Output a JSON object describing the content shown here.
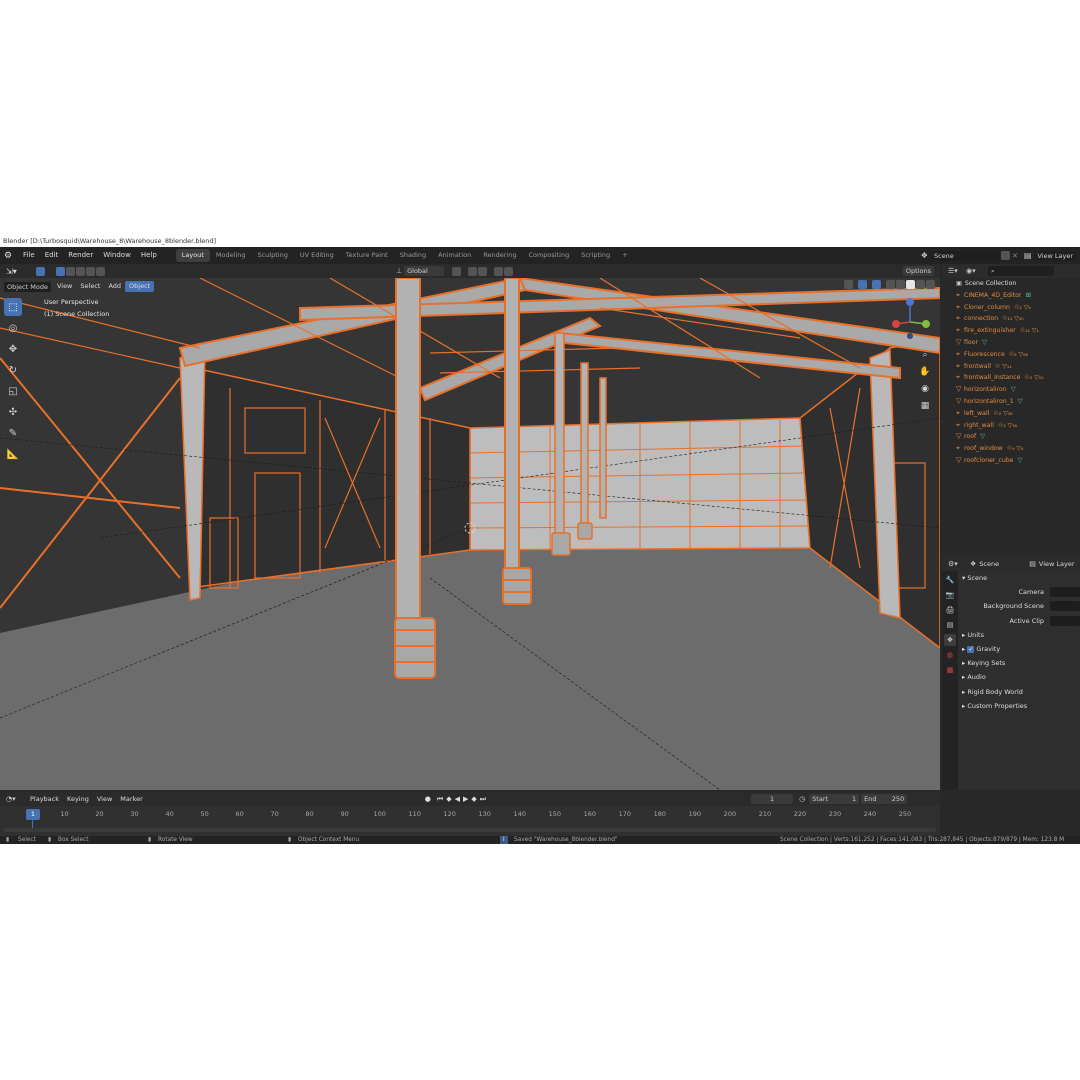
{
  "window_title": "Blender [D:\\Turbosquid\\Warehouse_8\\Warehouse_8blender.blend]",
  "menu": [
    "File",
    "Edit",
    "Render",
    "Window",
    "Help"
  ],
  "workspace_tabs": [
    "Layout",
    "Modeling",
    "Sculpting",
    "UV Editing",
    "Texture Paint",
    "Shading",
    "Animation",
    "Rendering",
    "Compositing",
    "Scripting"
  ],
  "add_workspace": "+",
  "scene_selector": "Scene",
  "view_layer_selector": "View Layer",
  "viewport_header": {
    "orientation": "Global",
    "options": "Options"
  },
  "viewport_menu": {
    "mode": "Object Mode",
    "items": [
      "View",
      "Select",
      "Add",
      "Object"
    ]
  },
  "viewport_info": {
    "perspective": "User Perspective",
    "collection": "(1) Scene Collection"
  },
  "outliner": {
    "root": "Scene Collection",
    "items": [
      {
        "name": "CINEMA_4D_Editor",
        "mods": ""
      },
      {
        "name": "Cloner_column",
        "mods": "♲₂ ▽₉"
      },
      {
        "name": "connection",
        "mods": "♲₁₁ ▽₄₀"
      },
      {
        "name": "fire_extinguisher",
        "mods": "♲₁₂ ▽₁"
      },
      {
        "name": "floor",
        "mods": ""
      },
      {
        "name": "Fluorescence",
        "mods": "♲₈ ▽₆₈"
      },
      {
        "name": "frontwall",
        "mods": "♲ ▽₁₁"
      },
      {
        "name": "frontwall_Instance",
        "mods": "♲₂ ▽₁₀"
      },
      {
        "name": "horizontaliron",
        "mods": ""
      },
      {
        "name": "horizontaliron_1",
        "mods": ""
      },
      {
        "name": "left_wall",
        "mods": "♲₂ ▽₃₆"
      },
      {
        "name": "right_wall",
        "mods": "♲₂ ▽₃₆"
      },
      {
        "name": "roof",
        "mods": ""
      },
      {
        "name": "roof_window",
        "mods": "♲₉ ▽₈"
      },
      {
        "name": "roofcloner_cube",
        "mods": ""
      }
    ]
  },
  "properties": {
    "tab_scene": "Scene",
    "tab_view_layer": "View Layer",
    "section": "Scene",
    "fields": [
      "Camera",
      "Background Scene",
      "Active Clip"
    ],
    "panels": [
      "Units",
      "Gravity",
      "Keying Sets",
      "Audio",
      "Rigid Body World",
      "Custom Properties"
    ]
  },
  "timeline": {
    "menu": [
      "Playback",
      "Keying",
      "View",
      "Marker"
    ],
    "current_frame": "1",
    "start_label": "Start",
    "start": "1",
    "end_label": "End",
    "end": "250",
    "ticks": [
      "1",
      "10",
      "20",
      "30",
      "40",
      "50",
      "60",
      "70",
      "80",
      "90",
      "100",
      "110",
      "120",
      "130",
      "140",
      "150",
      "160",
      "170",
      "180",
      "190",
      "200",
      "210",
      "220",
      "230",
      "240",
      "250"
    ]
  },
  "statusbar": {
    "select": "Select",
    "box_select": "Box Select",
    "rotate": "Rotate View",
    "context": "Object Context Menu",
    "saved": "Saved \"Warehouse_8blender.blend\"",
    "stats": "Scene Collection | Verts:161,252 | Faces:141,083 | Tris:287,845 | Objects:879/879 | Mem: 123.8 M"
  },
  "colors": {
    "selection": "#e8702a",
    "accent": "#4772b3",
    "floor": "#6e6e6e",
    "structure": "#b9b9b9"
  }
}
